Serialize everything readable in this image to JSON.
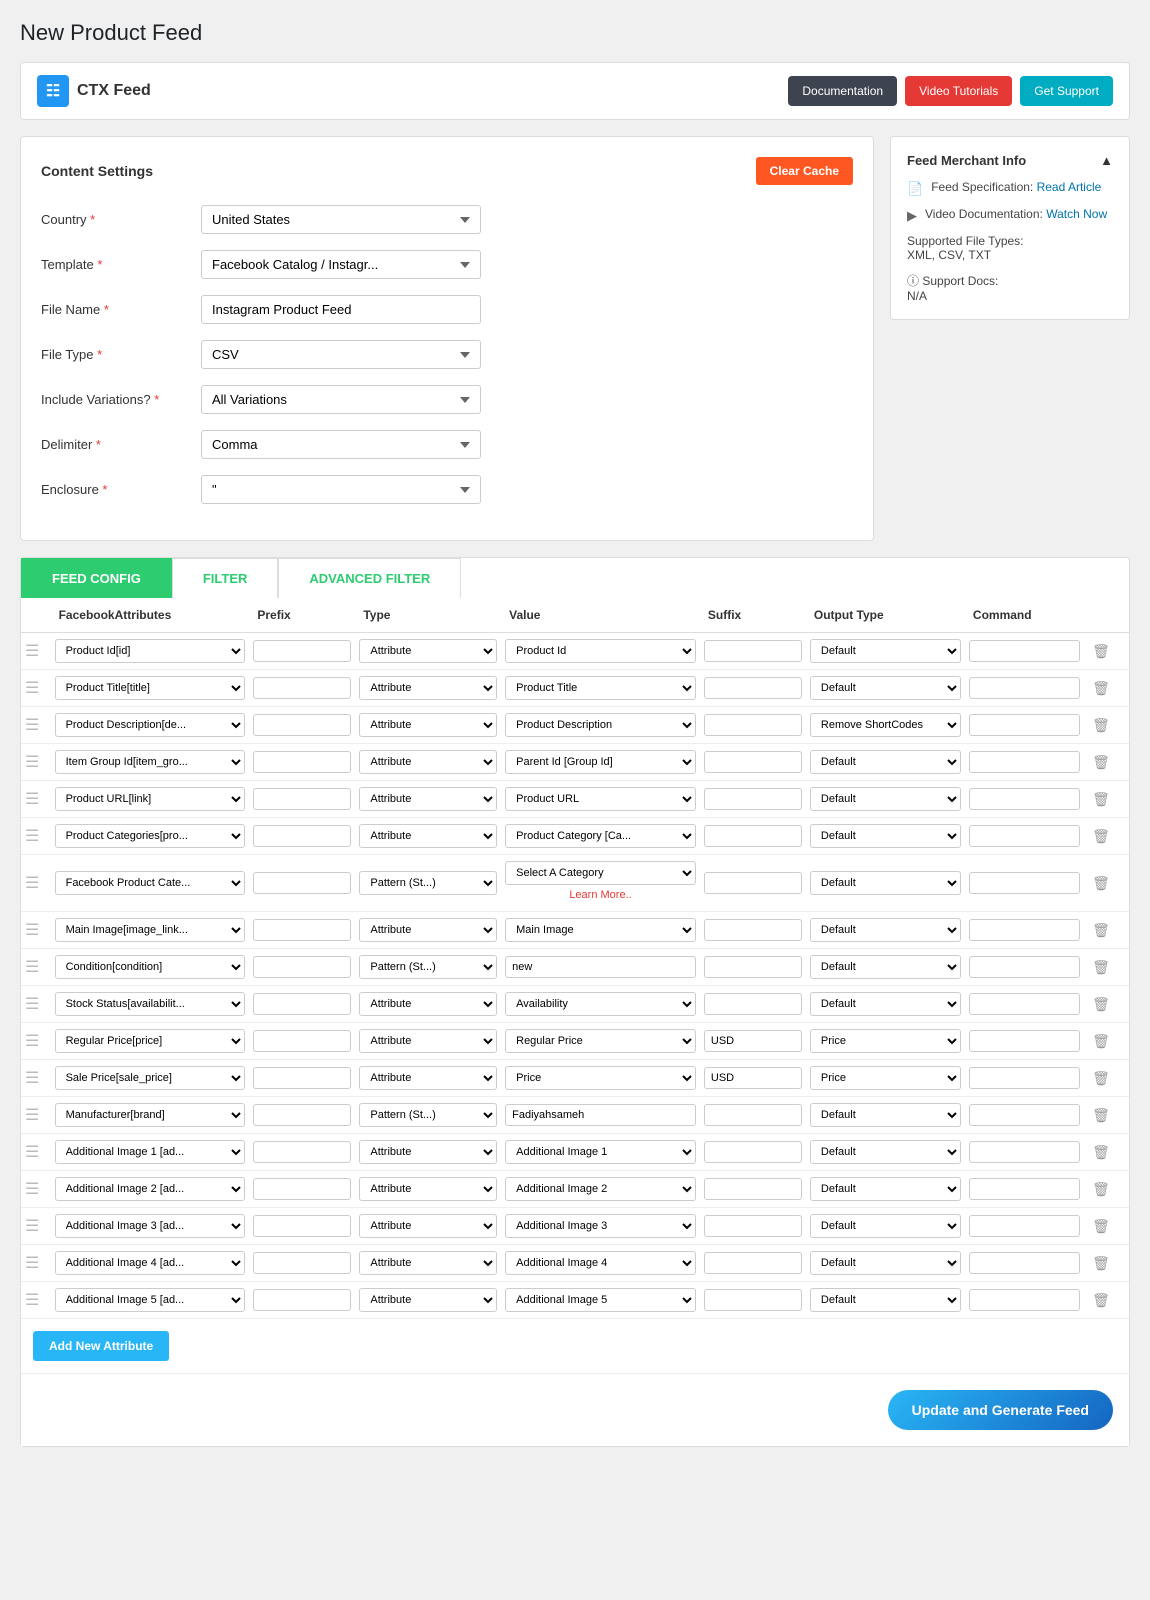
{
  "page": {
    "title": "New Product Feed"
  },
  "header": {
    "logo_text": "CTX Feed",
    "btn_docs": "Documentation",
    "btn_video": "Video Tutorials",
    "btn_support": "Get Support"
  },
  "content_settings": {
    "title": "Content Settings",
    "clear_cache_label": "Clear Cache",
    "fields": [
      {
        "label": "Country",
        "required": true,
        "type": "select",
        "value": "United States"
      },
      {
        "label": "Template",
        "required": true,
        "type": "select",
        "value": "Facebook Catalog / Instagr..."
      },
      {
        "label": "File Name",
        "required": true,
        "type": "text",
        "value": "Instagram Product Feed"
      },
      {
        "label": "File Type",
        "required": true,
        "type": "select",
        "value": "CSV"
      },
      {
        "label": "Include Variations?",
        "required": true,
        "type": "select",
        "value": "All Variations"
      },
      {
        "label": "Delimiter",
        "required": true,
        "type": "select",
        "value": "Comma"
      },
      {
        "label": "Enclosure",
        "required": true,
        "type": "select",
        "value": "\""
      }
    ]
  },
  "merchant_info": {
    "title": "Feed Merchant Info",
    "feed_spec_label": "Feed Specification:",
    "feed_spec_link": "Read Article",
    "video_doc_label": "Video Documentation:",
    "video_doc_link": "Watch Now",
    "supported_label": "Supported File Types:",
    "supported_types": "XML, CSV, TXT",
    "support_docs_label": "Support Docs:",
    "support_docs_value": "N/A"
  },
  "tabs": [
    {
      "label": "FEED CONFIG",
      "active": true
    },
    {
      "label": "FILTER",
      "active": false
    },
    {
      "label": "ADVANCED FILTER",
      "active": false
    }
  ],
  "table_headers": [
    "FacebookAttributes",
    "Prefix",
    "Type",
    "Value",
    "Suffix",
    "Output Type",
    "Command"
  ],
  "rows": [
    {
      "attr": "Product Id[id]",
      "prefix": "",
      "type": "Attribute",
      "value": "Product Id",
      "suffix": "",
      "output": "Default",
      "command": ""
    },
    {
      "attr": "Product Title[title]",
      "prefix": "",
      "type": "Attribute",
      "value": "Product Title",
      "suffix": "",
      "output": "Default",
      "command": ""
    },
    {
      "attr": "Product Description[de...",
      "prefix": "",
      "type": "Attribute",
      "value": "Product Description",
      "suffix": "",
      "output": "Remove ShortCodes",
      "command": ""
    },
    {
      "attr": "Item Group Id[item_gro...",
      "prefix": "",
      "type": "Attribute",
      "value": "Parent Id [Group Id]",
      "suffix": "",
      "output": "Default",
      "command": ""
    },
    {
      "attr": "Product URL[link]",
      "prefix": "",
      "type": "Attribute",
      "value": "Product URL",
      "suffix": "",
      "output": "Default",
      "command": ""
    },
    {
      "attr": "Product Categories[pro...",
      "prefix": "",
      "type": "Attribute",
      "value": "Product Category [Ca...",
      "suffix": "",
      "output": "Default",
      "command": ""
    },
    {
      "attr": "Facebook Product Cate...",
      "prefix": "",
      "type": "Pattern (St...)",
      "value": "Select A Category",
      "suffix": "",
      "output": "Default",
      "command": "",
      "learn_more": true
    },
    {
      "attr": "Main Image[image_link...",
      "prefix": "",
      "type": "Attribute",
      "value": "Main Image",
      "suffix": "",
      "output": "Default",
      "command": ""
    },
    {
      "attr": "Condition[condition]",
      "prefix": "",
      "type": "Pattern (St...)",
      "value": "new",
      "suffix": "",
      "output": "Default",
      "command": ""
    },
    {
      "attr": "Stock Status[availabilit...",
      "prefix": "",
      "type": "Attribute",
      "value": "Availability",
      "suffix": "",
      "output": "Default",
      "command": ""
    },
    {
      "attr": "Regular Price[price]",
      "prefix": "",
      "type": "Attribute",
      "value": "Regular Price",
      "suffix": "USD",
      "output": "Price",
      "command": ""
    },
    {
      "attr": "Sale Price[sale_price]",
      "prefix": "",
      "type": "Attribute",
      "value": "Price",
      "suffix": "USD",
      "output": "Price",
      "command": ""
    },
    {
      "attr": "Manufacturer[brand]",
      "prefix": "",
      "type": "Pattern (St...)",
      "value": "Fadiyahsameh",
      "suffix": "",
      "output": "Default",
      "command": ""
    },
    {
      "attr": "Additional Image 1 [ad...",
      "prefix": "",
      "type": "Attribute",
      "value": "Additional Image 1",
      "suffix": "",
      "output": "Default",
      "command": ""
    },
    {
      "attr": "Additional Image 2 [ad...",
      "prefix": "",
      "type": "Attribute",
      "value": "Additional Image 2",
      "suffix": "",
      "output": "Default",
      "command": ""
    },
    {
      "attr": "Additional Image 3 [ad...",
      "prefix": "",
      "type": "Attribute",
      "value": "Additional Image 3",
      "suffix": "",
      "output": "Default",
      "command": ""
    },
    {
      "attr": "Additional Image 4 [ad...",
      "prefix": "",
      "type": "Attribute",
      "value": "Additional Image 4",
      "suffix": "",
      "output": "Default",
      "command": ""
    },
    {
      "attr": "Additional Image 5 [ad...",
      "prefix": "",
      "type": "Attribute",
      "value": "Additional Image 5",
      "suffix": "",
      "output": "Default",
      "command": ""
    }
  ],
  "add_attr_label": "Add New Attribute",
  "update_btn_label": "Update and Generate Feed",
  "learn_more_text": "Learn More.."
}
